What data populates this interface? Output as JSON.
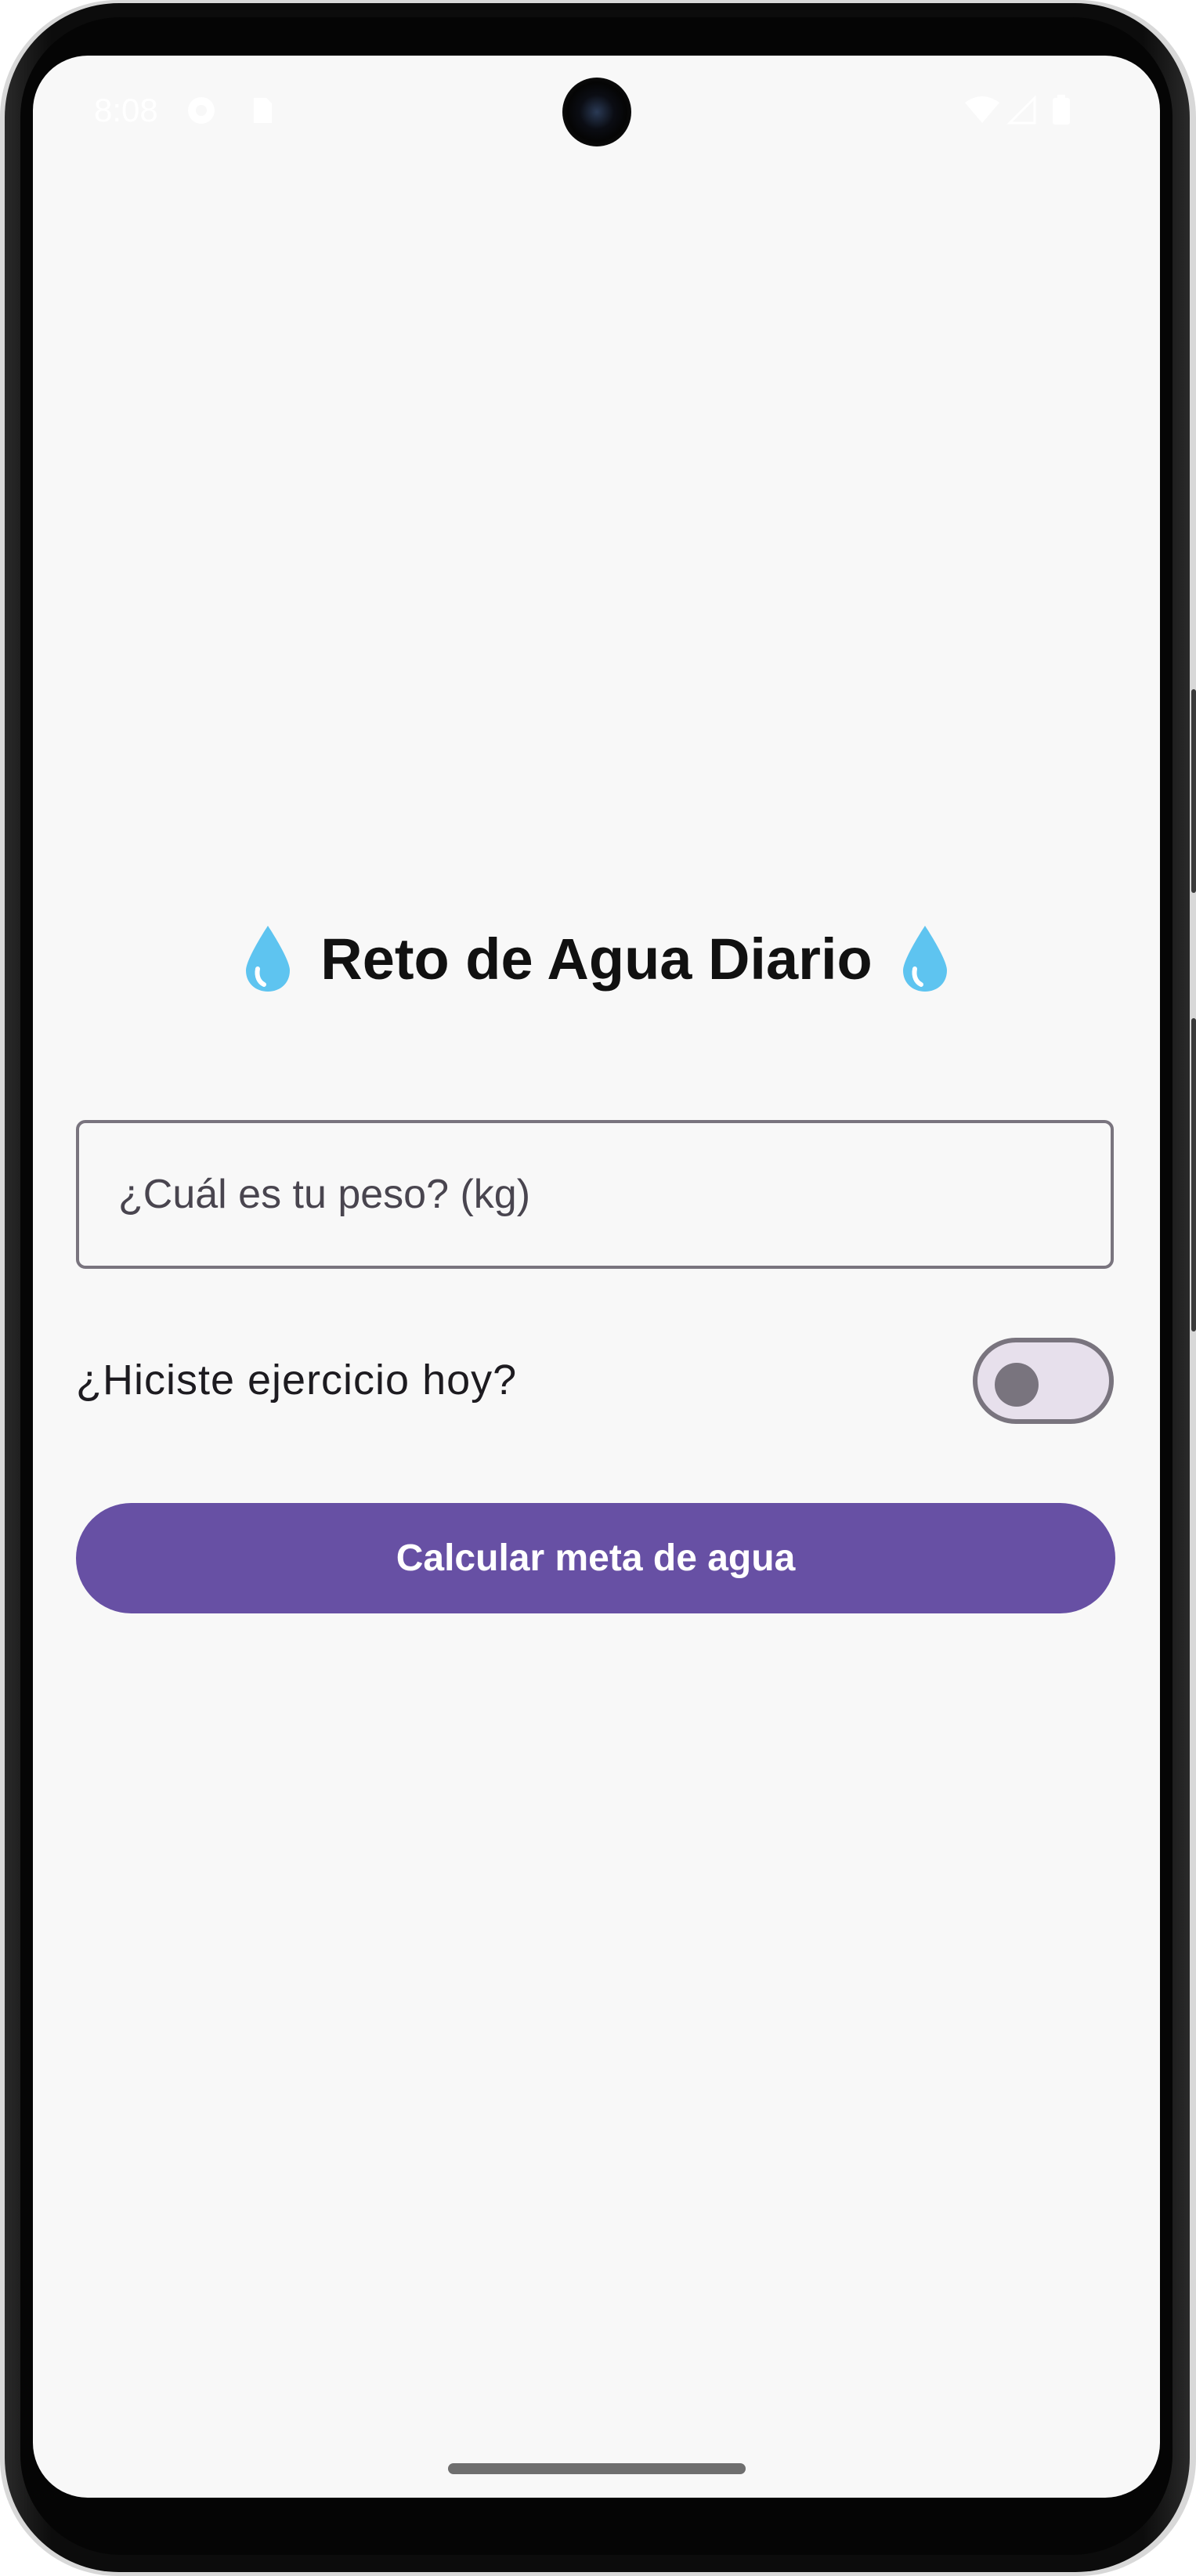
{
  "status_bar": {
    "time": "8:08"
  },
  "app": {
    "title": "Reto de Agua Diario",
    "title_icon": "water-drop-icon",
    "weight_input": {
      "placeholder": "¿Cuál es tu peso? (kg)",
      "value": ""
    },
    "exercise_toggle": {
      "label": "¿Hiciste ejercicio hoy?",
      "checked": false
    },
    "calculate_button": {
      "label": "Calcular meta de agua"
    }
  },
  "colors": {
    "primary": "#6750a4",
    "outline": "#79747e",
    "background": "#f8f8f8",
    "drop": "#5ec4f0"
  }
}
